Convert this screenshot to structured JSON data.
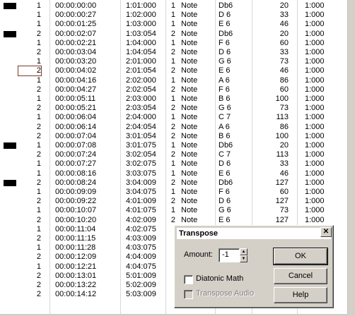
{
  "rows": [
    {
      "mark": true,
      "ch": "1",
      "time": "00:00:00:00",
      "meas": "1:01:000",
      "trk": "1",
      "type": "Note",
      "note": "Db6",
      "vel": "20",
      "dur": "1:000"
    },
    {
      "mark": false,
      "ch": "1",
      "time": "00:00:00:27",
      "meas": "1:02:000",
      "trk": "1",
      "type": "Note",
      "note": "D 6",
      "vel": "33",
      "dur": "1:000"
    },
    {
      "mark": false,
      "ch": "1",
      "time": "00:00:01:25",
      "meas": "1:03:000",
      "trk": "1",
      "type": "Note",
      "note": "E 6",
      "vel": "46",
      "dur": "1:000"
    },
    {
      "mark": true,
      "ch": "2",
      "time": "00:00:02:07",
      "meas": "1:03:054",
      "trk": "2",
      "type": "Note",
      "note": "Db6",
      "vel": "20",
      "dur": "1:000"
    },
    {
      "mark": false,
      "ch": "1",
      "time": "00:00:02:21",
      "meas": "1:04:000",
      "trk": "1",
      "type": "Note",
      "note": "F 6",
      "vel": "60",
      "dur": "1:000"
    },
    {
      "mark": false,
      "ch": "2",
      "time": "00:00:03:04",
      "meas": "1:04:054",
      "trk": "2",
      "type": "Note",
      "note": "D 6",
      "vel": "33",
      "dur": "1:000"
    },
    {
      "mark": false,
      "ch": "1",
      "time": "00:00:03:20",
      "meas": "2:01:000",
      "trk": "1",
      "type": "Note",
      "note": "G 6",
      "vel": "73",
      "dur": "1:000"
    },
    {
      "mark": false,
      "ch": "2",
      "time": "00:00:04:02",
      "meas": "2:01:054",
      "trk": "2",
      "type": "Note",
      "note": "E 6",
      "vel": "46",
      "dur": "1:000",
      "selected": true
    },
    {
      "mark": false,
      "ch": "1",
      "time": "00:00:04:16",
      "meas": "2:02:000",
      "trk": "1",
      "type": "Note",
      "note": "A 6",
      "vel": "86",
      "dur": "1:000"
    },
    {
      "mark": false,
      "ch": "2",
      "time": "00:00:04:27",
      "meas": "2:02:054",
      "trk": "2",
      "type": "Note",
      "note": "F 6",
      "vel": "60",
      "dur": "1:000"
    },
    {
      "mark": false,
      "ch": "1",
      "time": "00:00:05:11",
      "meas": "2:03:000",
      "trk": "1",
      "type": "Note",
      "note": "B 6",
      "vel": "100",
      "dur": "1:000"
    },
    {
      "mark": false,
      "ch": "2",
      "time": "00:00:05:21",
      "meas": "2:03:054",
      "trk": "2",
      "type": "Note",
      "note": "G 6",
      "vel": "73",
      "dur": "1:000"
    },
    {
      "mark": false,
      "ch": "1",
      "time": "00:00:06:04",
      "meas": "2:04:000",
      "trk": "1",
      "type": "Note",
      "note": "C 7",
      "vel": "113",
      "dur": "1:000"
    },
    {
      "mark": false,
      "ch": "2",
      "time": "00:00:06:14",
      "meas": "2:04:054",
      "trk": "2",
      "type": "Note",
      "note": "A 6",
      "vel": "86",
      "dur": "1:000"
    },
    {
      "mark": false,
      "ch": "2",
      "time": "00:00:07:04",
      "meas": "3:01:054",
      "trk": "2",
      "type": "Note",
      "note": "B 6",
      "vel": "100",
      "dur": "1:000"
    },
    {
      "mark": true,
      "ch": "1",
      "time": "00:00:07:08",
      "meas": "3:01:075",
      "trk": "1",
      "type": "Note",
      "note": "Db6",
      "vel": "20",
      "dur": "1:000"
    },
    {
      "mark": false,
      "ch": "2",
      "time": "00:00:07:24",
      "meas": "3:02:054",
      "trk": "2",
      "type": "Note",
      "note": "C 7",
      "vel": "113",
      "dur": "1:000"
    },
    {
      "mark": false,
      "ch": "1",
      "time": "00:00:07:27",
      "meas": "3:02:075",
      "trk": "1",
      "type": "Note",
      "note": "D 6",
      "vel": "33",
      "dur": "1:000"
    },
    {
      "mark": false,
      "ch": "1",
      "time": "00:00:08:16",
      "meas": "3:03:075",
      "trk": "1",
      "type": "Note",
      "note": "E 6",
      "vel": "46",
      "dur": "1:000"
    },
    {
      "mark": true,
      "ch": "2",
      "time": "00:00:08:24",
      "meas": "3:04:009",
      "trk": "2",
      "type": "Note",
      "note": "Db6",
      "vel": "127",
      "dur": "1:000"
    },
    {
      "mark": false,
      "ch": "1",
      "time": "00:00:09:09",
      "meas": "3:04:075",
      "trk": "1",
      "type": "Note",
      "note": "F 6",
      "vel": "60",
      "dur": "1:000"
    },
    {
      "mark": false,
      "ch": "2",
      "time": "00:00:09:22",
      "meas": "4:01:009",
      "trk": "2",
      "type": "Note",
      "note": "D 6",
      "vel": "127",
      "dur": "1:000"
    },
    {
      "mark": false,
      "ch": "1",
      "time": "00:00:10:07",
      "meas": "4:01:075",
      "trk": "1",
      "type": "Note",
      "note": "G 6",
      "vel": "73",
      "dur": "1:000"
    },
    {
      "mark": false,
      "ch": "2",
      "time": "00:00:10:20",
      "meas": "4:02:009",
      "trk": "2",
      "type": "Note",
      "note": "E 6",
      "vel": "127",
      "dur": "1:000"
    },
    {
      "mark": false,
      "ch": "1",
      "time": "00:00:11:04",
      "meas": "4:02:075",
      "trk": "",
      "type": "",
      "note": "",
      "vel": "",
      "dur": ""
    },
    {
      "mark": false,
      "ch": "2",
      "time": "00:00:11:15",
      "meas": "4:03:009",
      "trk": "",
      "type": "",
      "note": "",
      "vel": "",
      "dur": ""
    },
    {
      "mark": false,
      "ch": "1",
      "time": "00:00:11:28",
      "meas": "4:03:075",
      "trk": "",
      "type": "",
      "note": "",
      "vel": "",
      "dur": ""
    },
    {
      "mark": false,
      "ch": "2",
      "time": "00:00:12:09",
      "meas": "4:04:009",
      "trk": "",
      "type": "",
      "note": "",
      "vel": "",
      "dur": ""
    },
    {
      "mark": false,
      "ch": "1",
      "time": "00:00:12:21",
      "meas": "4:04:075",
      "trk": "",
      "type": "",
      "note": "",
      "vel": "",
      "dur": ""
    },
    {
      "mark": false,
      "ch": "2",
      "time": "00:00:13:01",
      "meas": "5:01:009",
      "trk": "",
      "type": "",
      "note": "",
      "vel": "",
      "dur": ""
    },
    {
      "mark": false,
      "ch": "2",
      "time": "00:00:13:22",
      "meas": "5:02:009",
      "trk": "",
      "type": "",
      "note": "",
      "vel": "",
      "dur": ""
    },
    {
      "mark": false,
      "ch": "2",
      "time": "00:00:14:12",
      "meas": "5:03:009",
      "trk": "",
      "type": "",
      "note": "",
      "vel": "",
      "dur": ""
    }
  ],
  "dialog": {
    "title": "Transpose",
    "close_glyph": "✕",
    "amount_label": "Amount:",
    "amount_value": "-1",
    "spin_up": "▲",
    "spin_down": "▼",
    "diatonic_label": "Diatonic Math",
    "diatonic_checked": false,
    "transpose_audio_label": "Transpose Audio",
    "transpose_audio_enabled": false,
    "ok_label": "OK",
    "cancel_label": "Cancel",
    "help_label": "Help"
  }
}
